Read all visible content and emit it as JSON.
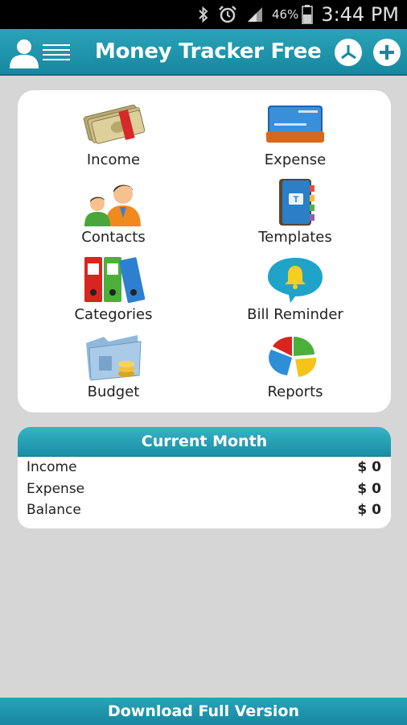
{
  "status_bar": {
    "battery_percent": "46%",
    "time": "3:44 PM",
    "icons": [
      "bluetooth-icon",
      "alarm-icon",
      "signal-icon",
      "battery-icon"
    ]
  },
  "header": {
    "title": "Money Tracker Free",
    "left_icons": [
      "profile-icon",
      "menu-icon"
    ],
    "right_icons": [
      "chart-icon",
      "add-icon"
    ]
  },
  "menu": {
    "items": [
      {
        "label": "Income",
        "icon": "money-icon"
      },
      {
        "label": "Expense",
        "icon": "credit-card-icon"
      },
      {
        "label": "Contacts",
        "icon": "contacts-icon"
      },
      {
        "label": "Templates",
        "icon": "notebook-icon"
      },
      {
        "label": "Categories",
        "icon": "binders-icon"
      },
      {
        "label": "Bill Reminder",
        "icon": "bell-icon"
      },
      {
        "label": "Budget",
        "icon": "folder-coins-icon"
      },
      {
        "label": "Reports",
        "icon": "pie-chart-icon"
      }
    ]
  },
  "current_month": {
    "title": "Current Month",
    "rows": [
      {
        "label": "Income",
        "value": "$ 0"
      },
      {
        "label": "Expense",
        "value": "$ 0"
      },
      {
        "label": "Balance",
        "value": "$ 0"
      }
    ]
  },
  "footer": {
    "label": "Download Full Version"
  },
  "colors": {
    "header": "#1f97ad",
    "background": "#d6d6d6",
    "card": "#ffffff"
  }
}
